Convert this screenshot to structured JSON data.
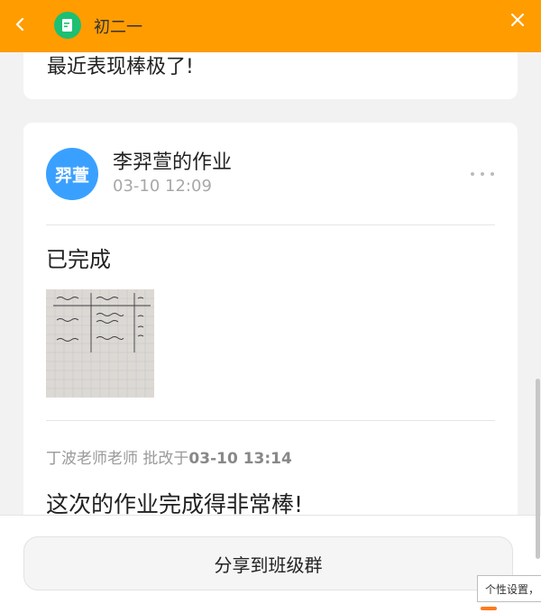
{
  "header": {
    "title": "初二一",
    "back_icon": "chevron-left-icon",
    "app_icon": "edit-note-icon",
    "close_icon": "close-icon",
    "bar_color": "#ff9c00"
  },
  "previous_card": {
    "text": "最近表现棒极了!"
  },
  "homework_card": {
    "avatar_text": "羿萱",
    "title": "李羿萱的作业",
    "datetime": "03-10 12:09",
    "more_icon": "more-horizontal-icon",
    "status": "已完成",
    "image_icon": "homework-photo",
    "corrected_by": "丁波老师老师",
    "corrected_prefix": "批改于",
    "corrected_time": "03-10 13:14",
    "comment": "这次的作业完成得非常棒!"
  },
  "bottom": {
    "share_label": "分享到班级群"
  },
  "tooltip": {
    "text": "个性设置，"
  },
  "colors": {
    "accent": "#ff9c00",
    "avatar": "#3aa0ff",
    "app_icon": "#1dbf73"
  }
}
